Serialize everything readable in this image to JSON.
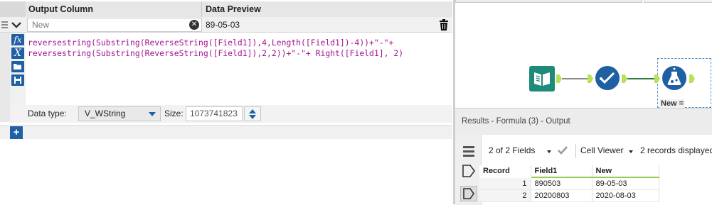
{
  "formula_panel": {
    "headers": {
      "output_column": "Output Column",
      "data_preview": "Data Preview"
    },
    "row": {
      "name_placeholder": "New",
      "clear_icon": "clear-x-icon",
      "preview_value": "89-05-03",
      "delete_icon": "trash-icon"
    },
    "expression_lines": [
      "reversestring(Substring(ReverseString([Field1]),4,Length([Field1])-4))+\"-\"+",
      "reversestring(Substring(ReverseString([Field1]),2,2))+\"-\"+ Right([Field1], 2)"
    ],
    "toolbar_icons": [
      "fx-icon",
      "variable-x-icon",
      "open-folder-icon",
      "save-icon"
    ],
    "data_type_label": "Data type:",
    "data_type_value": "V_WString",
    "size_label": "Size:",
    "size_value": "1073741823",
    "add_button": "+"
  },
  "canvas": {
    "tools": [
      "input-data-tool-icon",
      "select-tool-icon",
      "formula-tool-icon"
    ],
    "selected_tool_label": "New ="
  },
  "results": {
    "title": "Results - Formula (3) - Output",
    "fields_text": "2 of 2 Fields",
    "viewer_text": "Cell Viewer",
    "records_text": "2 records displayed",
    "side_icons": [
      "list-icon",
      "input-anchor-icon",
      "output-anchor-icon"
    ],
    "columns": [
      "Record",
      "Field1",
      "New"
    ],
    "rows": [
      {
        "record": "1",
        "field1": "890503",
        "new": "89-05-03"
      },
      {
        "record": "2",
        "field1": "20200803",
        "new": "2020-08-03"
      }
    ]
  },
  "colors": {
    "accent_blue": "#1f5fa3",
    "anchor_green": "#b8e05a",
    "teal_tool": "#1d8a7a",
    "select_tool": "#1f5fa3",
    "formula_tool": "#1f5fa3"
  }
}
